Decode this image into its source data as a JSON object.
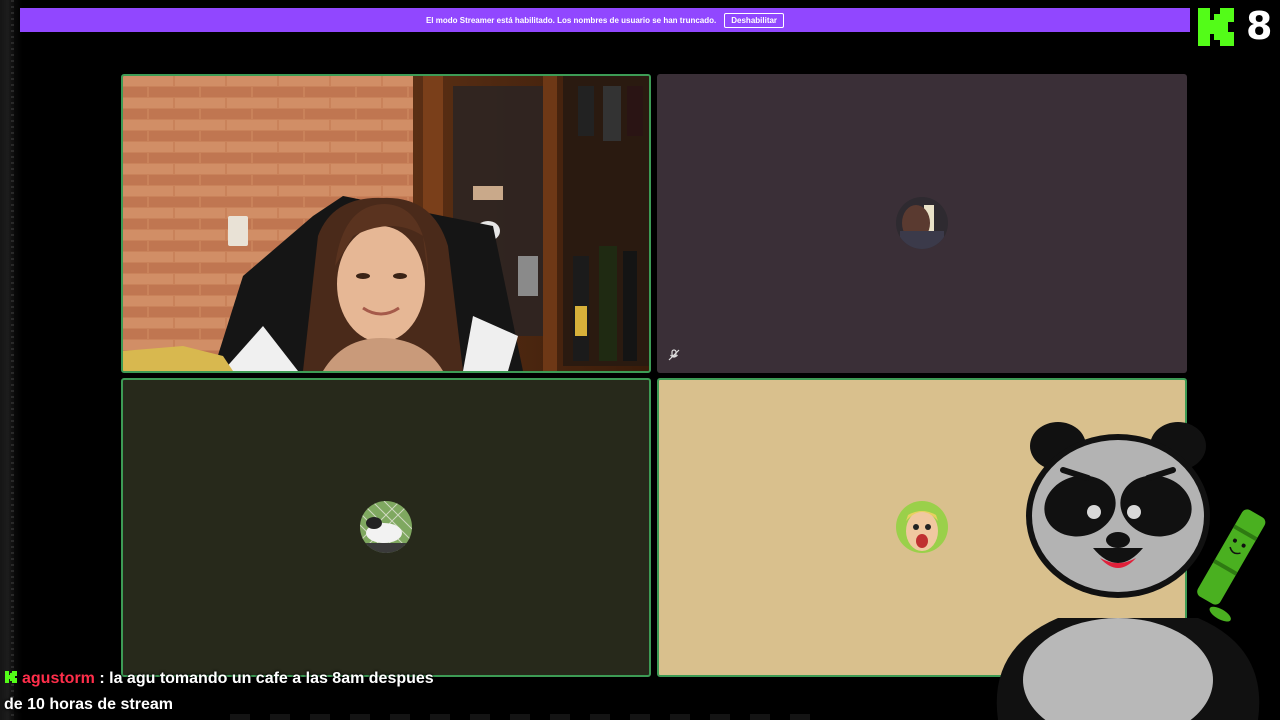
{
  "banner": {
    "message": "El modo Streamer está habilitado. Los nombres de usuario se han truncado.",
    "button_label": "Deshabilitar",
    "color": "#9147ff"
  },
  "overlay": {
    "logo_icon": "kick-k-icon",
    "counter": "8",
    "logo_color": "#53fc18"
  },
  "tiles": [
    {
      "id": "webcam-girl",
      "background": "#7a4a2a",
      "active_border": "#3d9b55"
    },
    {
      "id": "participant-2",
      "background": "#3a2f37",
      "muted": true
    },
    {
      "id": "participant-3",
      "background": "#27291b",
      "active_border": "#3d9b55"
    },
    {
      "id": "participant-4",
      "background": "#d9c08d",
      "active_border": "#3d9b55"
    }
  ],
  "mute_icon": "mic-off-icon",
  "mascot": {
    "icon": "panda-mascot",
    "accessory": "bamboo-icon"
  },
  "chat": {
    "username": "agustorm",
    "separator": ":",
    "message": "la agu tomando un cafe a las 8am despues de 10 horas de stream",
    "badge_icon": "kick-badge-icon",
    "username_color": "#ff2e4a"
  }
}
